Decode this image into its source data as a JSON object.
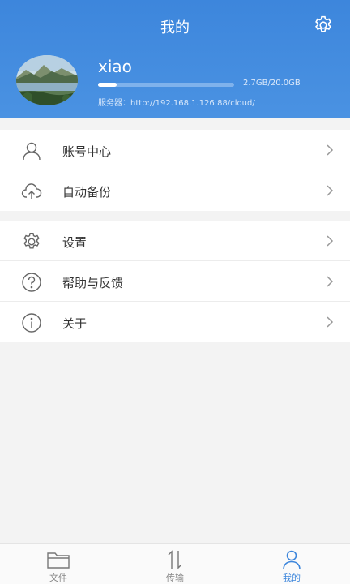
{
  "header": {
    "title": "我的"
  },
  "profile": {
    "username": "xiao",
    "storage_text": "2.7GB/20.0GB",
    "storage_used_fraction": 0.135,
    "server_text": "服务器：http://192.168.1.126:88/cloud/"
  },
  "menu": {
    "group1": [
      {
        "label": "账号中心",
        "icon": "person-icon"
      },
      {
        "label": "自动备份",
        "icon": "cloud-upload-icon"
      }
    ],
    "group2": [
      {
        "label": "设置",
        "icon": "gear-icon"
      },
      {
        "label": "帮助与反馈",
        "icon": "question-icon"
      },
      {
        "label": "关于",
        "icon": "info-icon"
      }
    ]
  },
  "tabs": [
    {
      "label": "文件",
      "icon": "folder-icon",
      "active": false
    },
    {
      "label": "传输",
      "icon": "transfer-icon",
      "active": false
    },
    {
      "label": "我的",
      "icon": "person-icon",
      "active": true
    }
  ],
  "colors": {
    "accent": "#3d86dc",
    "header_bg": "#4a92e2"
  }
}
